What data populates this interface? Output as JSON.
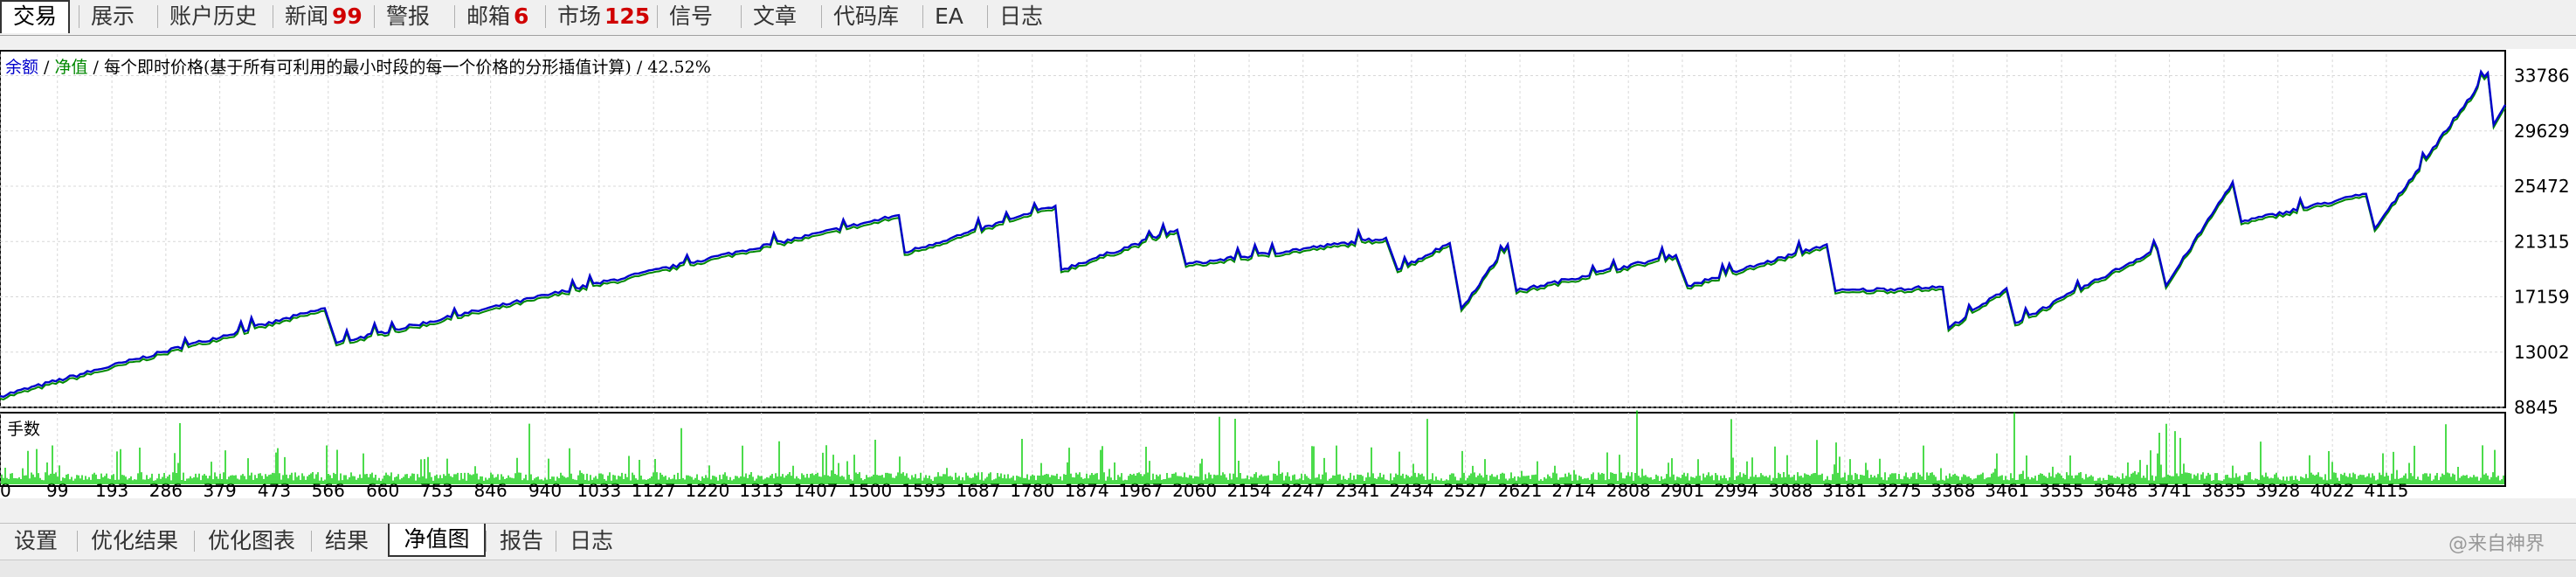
{
  "top_tabs": [
    {
      "label": "交易",
      "badge": "",
      "active": true
    },
    {
      "label": "展示",
      "badge": "",
      "active": false
    },
    {
      "label": "账户历史",
      "badge": "",
      "active": false
    },
    {
      "label": "新闻",
      "badge": "99",
      "active": false
    },
    {
      "label": "警报",
      "badge": "",
      "active": false
    },
    {
      "label": "邮箱",
      "badge": "6",
      "active": false
    },
    {
      "label": "市场",
      "badge": "125",
      "active": false
    },
    {
      "label": "信号",
      "badge": "",
      "active": false
    },
    {
      "label": "文章",
      "badge": "",
      "active": false
    },
    {
      "label": "代码库",
      "badge": "",
      "active": false
    },
    {
      "label": "EA",
      "badge": "",
      "active": false
    },
    {
      "label": "日志",
      "badge": "",
      "active": false
    }
  ],
  "legend": {
    "balance": "余额",
    "slash1": " / ",
    "equity": "净值",
    "rest": " / 每个即时价格(基于所有可利用的最小时段的每一个价格的分形插值计算) / 42.52%"
  },
  "volume_label": "手数",
  "bottom_tabs": [
    {
      "label": "设置",
      "active": false
    },
    {
      "label": "优化结果",
      "active": false
    },
    {
      "label": "优化图表",
      "active": false
    },
    {
      "label": "结果",
      "active": false
    },
    {
      "label": "净值图",
      "active": true
    },
    {
      "label": "报告",
      "active": false
    },
    {
      "label": "日志",
      "active": false
    }
  ],
  "watermark": "@来自神界",
  "colors": {
    "balance": "#0000cc",
    "equity": "#008800",
    "volume": "#00cc00",
    "grid": "#d8d8d8"
  },
  "chart_data": {
    "type": "line",
    "y_tick_labels": [
      "33786",
      "29629",
      "25472",
      "21315",
      "17159",
      "13002",
      "8845"
    ],
    "x_tick_labels": [
      "0",
      "99",
      "193",
      "286",
      "379",
      "473",
      "566",
      "660",
      "753",
      "846",
      "940",
      "1033",
      "1127",
      "1220",
      "1313",
      "1407",
      "1500",
      "1593",
      "1687",
      "1780",
      "1874",
      "1967",
      "2060",
      "2154",
      "2247",
      "2341",
      "2434",
      "2527",
      "2621",
      "2714",
      "2808",
      "2901",
      "2994",
      "3088",
      "3181",
      "3275",
      "3368",
      "3461",
      "3555",
      "3648",
      "3741",
      "3835",
      "3928",
      "4022",
      "4115"
    ],
    "ylim": [
      8845,
      35400
    ],
    "xlim": [
      0,
      4320
    ],
    "grid": true,
    "series": [
      {
        "name": "余额",
        "x": [
          0,
          560,
          580,
          1550,
          1560,
          1820,
          1830,
          2030,
          2045,
          2390,
          2410,
          2500,
          2520,
          2600,
          2615,
          2890,
          2910,
          3150,
          3165,
          3350,
          3360,
          3460,
          3475,
          3720,
          3735,
          3850,
          3865,
          4080,
          4095,
          4290,
          4300,
          4320
        ],
        "y": [
          9700,
          16300,
          13700,
          23300,
          20500,
          24000,
          19200,
          22200,
          19600,
          21600,
          19200,
          21200,
          16300,
          21100,
          17600,
          20300,
          18000,
          21100,
          17600,
          17900,
          14800,
          17800,
          15200,
          20800,
          18000,
          25800,
          22800,
          24900,
          22300,
          34000,
          30100,
          31600
        ]
      }
    ],
    "volume_spikes": {
      "approx_count": 4320,
      "max_label": "手数"
    }
  }
}
